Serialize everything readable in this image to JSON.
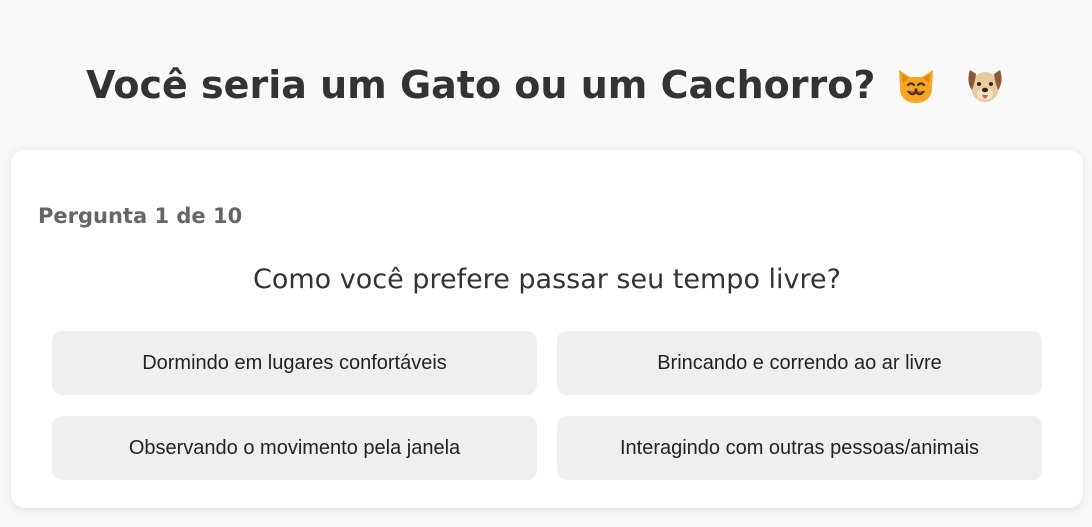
{
  "header": {
    "title": "Você seria um Gato ou um Cachorro?",
    "emojis": [
      "cat-face-icon",
      "dog-face-icon"
    ]
  },
  "quiz": {
    "progress": "Pergunta 1 de 10",
    "question": "Como você prefere passar seu tempo livre?",
    "options": [
      "Dormindo em lugares confortáveis",
      "Brincando e correndo ao ar livre",
      "Observando o movimento pela janela",
      "Interagindo com outras pessoas/animais"
    ]
  },
  "colors": {
    "background": "#f9f9f9",
    "card": "#ffffff",
    "option_bg": "#efefef",
    "title_text": "#333333",
    "progress_text": "#666666"
  }
}
